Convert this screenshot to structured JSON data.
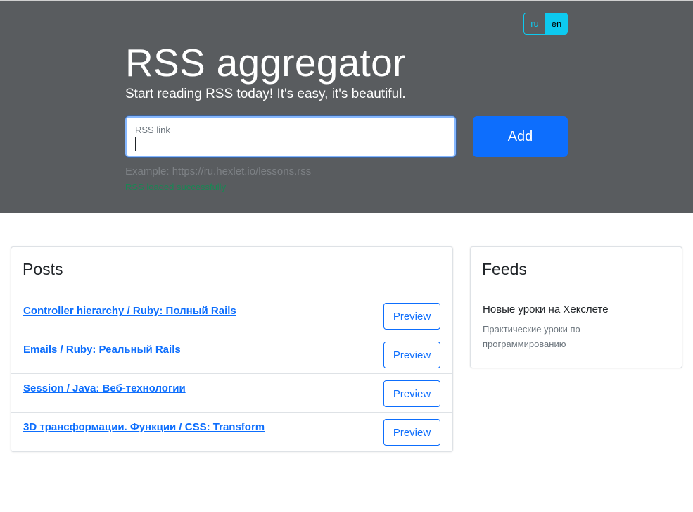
{
  "lang": {
    "ru": "ru",
    "en": "en",
    "active": "en"
  },
  "hero": {
    "title": "RSS aggregator",
    "subtitle": "Start reading RSS today! It's easy, it's beautiful.",
    "input_label": "RSS link",
    "input_value": "",
    "add_label": "Add",
    "example": "Example: https://ru.hexlet.io/lessons.rss",
    "feedback": "RSS loaded successfully"
  },
  "posts": {
    "title": "Posts",
    "preview_label": "Preview",
    "items": [
      {
        "title": "Controller hierarchy / Ruby: Полный Rails"
      },
      {
        "title": "Emails / Ruby: Реальный Rails"
      },
      {
        "title": "Session / Java: Веб-технологии"
      },
      {
        "title": "3D трансформации. Функции / CSS: Transform"
      }
    ]
  },
  "feeds": {
    "title": "Feeds",
    "items": [
      {
        "title": "Новые уроки на Хекслете",
        "description": "Практические уроки по программированию"
      }
    ]
  },
  "colors": {
    "hero_bg": "#595c5f",
    "primary": "#0d6efd",
    "info": "#0dcaf0",
    "success": "#198754"
  }
}
